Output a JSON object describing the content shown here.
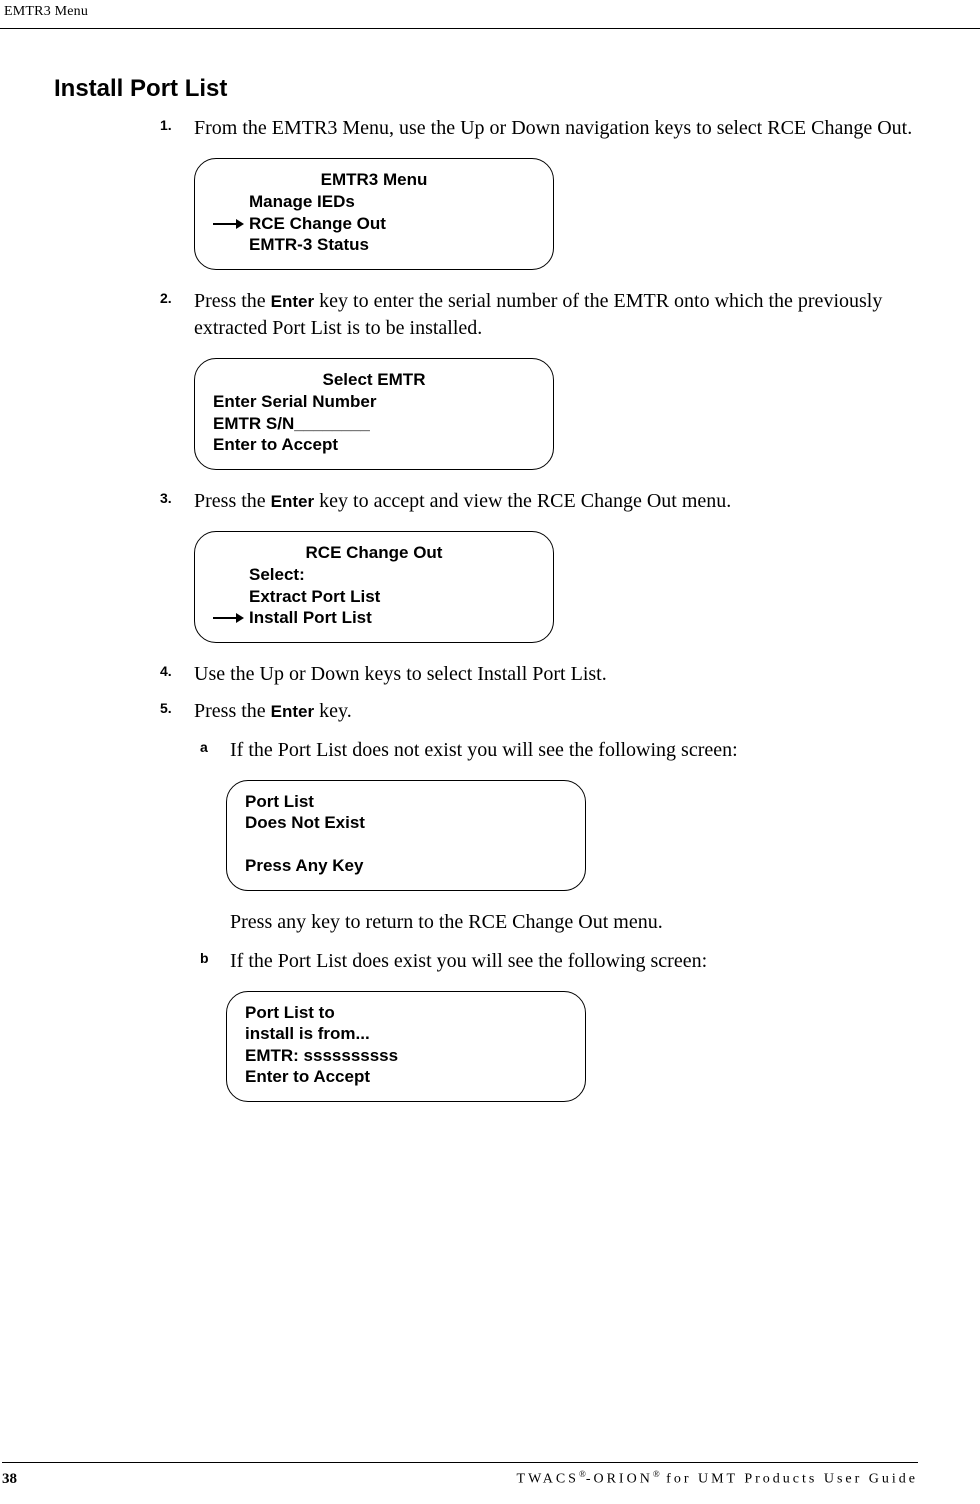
{
  "header": {
    "running": "EMTR3 Menu"
  },
  "section": {
    "title": "Install Port List"
  },
  "steps": [
    {
      "num": "1.",
      "text": "From the EMTR3 Menu, use the Up or Down navigation keys to select RCE Change Out.",
      "screen_title": "EMTR3 Menu",
      "screen_lines": [
        {
          "text": "Manage IEDs",
          "arrow": false
        },
        {
          "text": "RCE Change Out",
          "arrow": true
        },
        {
          "text": "EMTR-3 Status",
          "arrow": false
        }
      ]
    },
    {
      "num": "2.",
      "text_pre": "Press the ",
      "text_bold": "Enter",
      "text_post": " key to enter the serial number of the EMTR onto which the previously extracted Port List is to be installed.",
      "screen_title": "Select EMTR",
      "screen_lines_plain": [
        "Enter Serial Number",
        "EMTR S/N________",
        "Enter to Accept"
      ]
    },
    {
      "num": "3.",
      "text_pre": "Press the ",
      "text_bold": "Enter",
      "text_post": " key to accept and view the RCE Change Out menu.",
      "screen_title": "RCE Change Out",
      "screen_lines": [
        {
          "text": "Select:",
          "arrow": false
        },
        {
          "text": "Extract Port List",
          "arrow": false
        },
        {
          "text": "Install Port List",
          "arrow": true
        }
      ]
    },
    {
      "num": "4.",
      "text": "Use the Up or Down keys to select Install Port List."
    },
    {
      "num": "5.",
      "text_pre": "Press the ",
      "text_bold": "Enter",
      "text_post": " key.",
      "subs": [
        {
          "sub": "a",
          "text": "If the Port List does not exist you will see the following screen:",
          "screen_lines_plain": [
            "Port List",
            "Does Not Exist",
            "",
            "Press Any Key"
          ],
          "after_text": "Press any key to return to the RCE Change Out menu."
        },
        {
          "sub": "b",
          "text": "If the Port List does exist you will see the following screen:",
          "screen_lines_plain": [
            "Port List to",
            "install is from...",
            "EMTR:  ssssssssss",
            "Enter to Accept"
          ]
        }
      ]
    }
  ],
  "footer": {
    "page": "38",
    "right_a": "TWACS",
    "right_b": "-ORION",
    "right_c": " for UMT Products User Guide",
    "reg": "®"
  }
}
